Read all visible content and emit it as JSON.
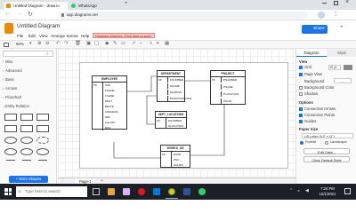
{
  "browser": {
    "tabs": [
      {
        "label": "Untitled Diagram - draw.io",
        "active": true
      },
      {
        "label": "WhatsApp",
        "active": false
      }
    ],
    "new_tab": "+",
    "url": "app.diagrams.net"
  },
  "app": {
    "doc_title": "Untitled Diagram",
    "menus": [
      "File",
      "Edit",
      "View",
      "Arrange",
      "Extras",
      "Help"
    ],
    "unsaved_banner": "Unsaved changes. Click here to save.",
    "share_label": "Share",
    "zoom": "60%"
  },
  "left_panel": {
    "sections": [
      "Misc",
      "Advanced",
      "Basic",
      "Arrows",
      "Flowchart",
      "Entity Relation"
    ],
    "more_shapes": "+ More Shapes"
  },
  "diagram": {
    "entities": [
      {
        "title": "EMPLOYEE",
        "rows": [
          {
            "key": "PK",
            "field": "SSN"
          },
          {
            "key": "",
            "field": "FNAME"
          },
          {
            "key": "",
            "field": "LNAME"
          },
          {
            "key": "",
            "field": "MINIT"
          },
          {
            "key": "",
            "field": "BDATE"
          },
          {
            "key": "",
            "field": "ADDRESS"
          },
          {
            "key": "",
            "field": "SEX"
          },
          {
            "key": "",
            "field": "SALARY"
          },
          {
            "key": "",
            "field": "DNO"
          }
        ]
      },
      {
        "title": "DEPARTMENT",
        "rows": [
          {
            "key": "PK",
            "field": "DNUMBER"
          },
          {
            "key": "",
            "field": "DNAME"
          },
          {
            "key": "",
            "field": "MGRSSN"
          },
          {
            "key": "",
            "field": "MGRSTARTDATE"
          }
        ]
      },
      {
        "title": "PROJECT",
        "rows": [
          {
            "key": "PK",
            "field": "PNUMBER"
          },
          {
            "key": "",
            "field": "PNAME"
          },
          {
            "key": "",
            "field": "PLOCATION"
          },
          {
            "key": "",
            "field": "DNUM"
          }
        ]
      },
      {
        "title": "DEPT_LOCATIONS",
        "rows": [
          {
            "key": "PK",
            "field": "DNUMBER"
          },
          {
            "key": "",
            "field": "DLOCATION"
          }
        ]
      },
      {
        "title": "WORKS_ON",
        "rows": [
          {
            "key": "PK",
            "field": "ESSN"
          },
          {
            "key": "",
            "field": "PNO"
          },
          {
            "key": "",
            "field": "HOURS"
          }
        ]
      }
    ]
  },
  "page_tabs": {
    "page_label": "Page-1",
    "add": "+"
  },
  "format_panel": {
    "tabs": [
      "Diagram",
      "Style"
    ],
    "view_label": "View",
    "grid_label": "Grid",
    "grid_value": "10 pt",
    "page_view_label": "Page View",
    "background_label": "Background",
    "bg_color_label": "Background Color",
    "shadow_label": "Shadow",
    "options_label": "Options",
    "conn_arrows": "Connection Arrows",
    "conn_points": "Connection Points",
    "guides": "Guides",
    "paper_size_label": "Paper Size",
    "paper_size_value": "US-Letter (8.5\" x 11\")",
    "portrait": "Portrait",
    "landscape": "Landscape",
    "edit_data": "Edit Data...",
    "clear_style": "Clear Default Style"
  },
  "taskbar": {
    "search_placeholder": "Type here to search",
    "time": "7:24 PM",
    "date": "12/1/2021"
  },
  "colors": {
    "accent": "#1a73e8",
    "taskbar": "#1c1f26"
  }
}
